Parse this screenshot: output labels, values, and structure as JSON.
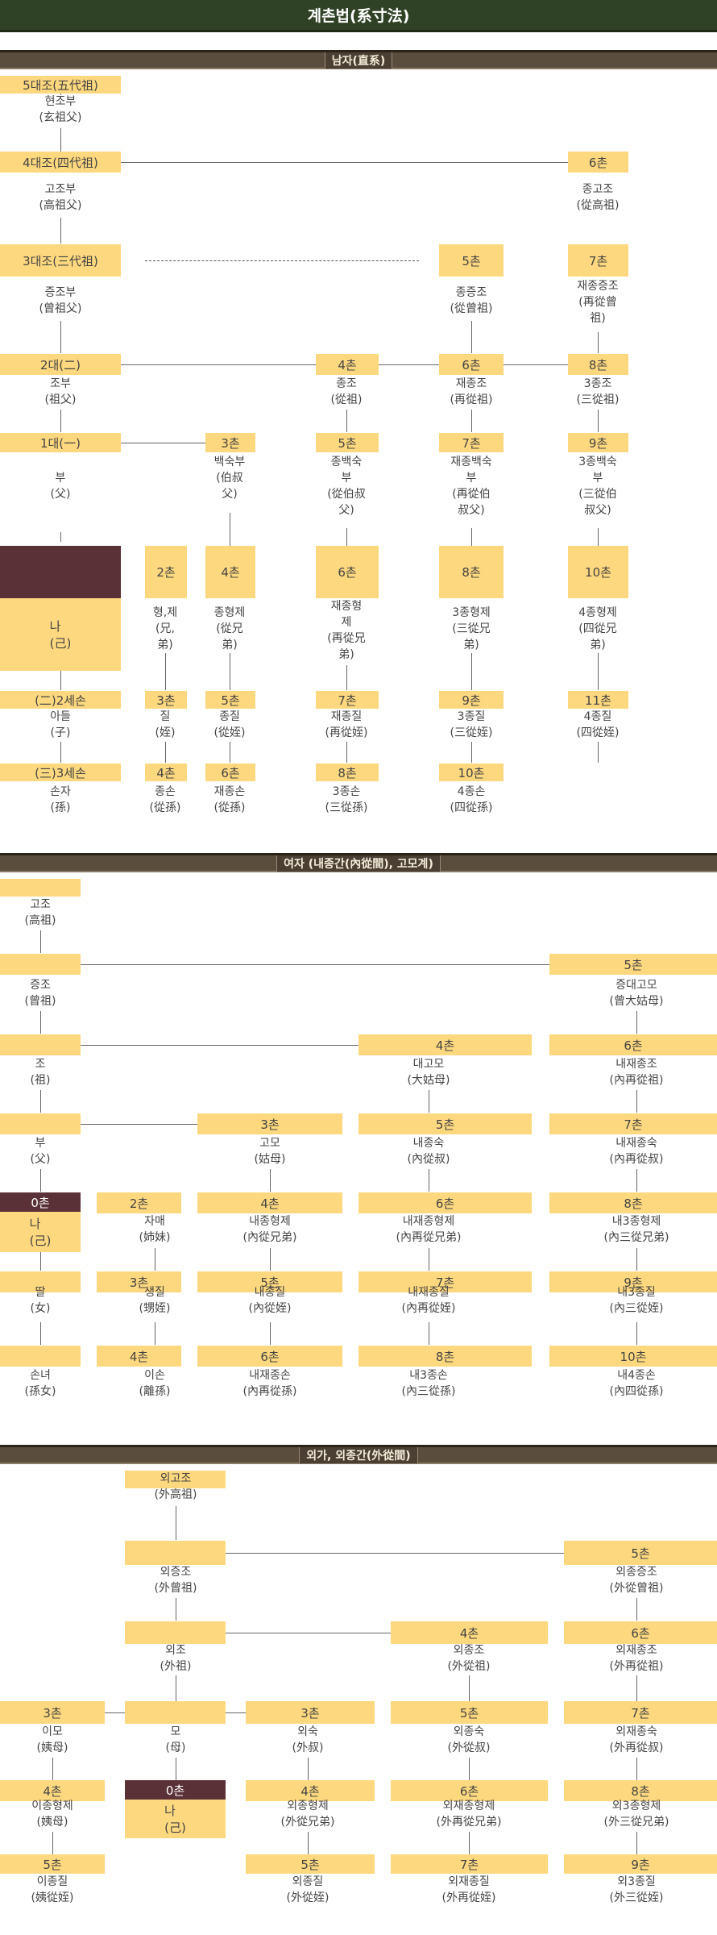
{
  "title": "계촌법(系寸法)",
  "section_headers": [
    "남자(直系)",
    "여자 (내종간(內從間), 고모계)",
    "외가, 외종간(外從間)"
  ],
  "male": {
    "boxes": [
      "5대조(五代祖)",
      "4대조(四代祖)",
      "6촌",
      "3대조(三代祖)",
      "5촌",
      "7촌",
      "2대(二)",
      "4촌",
      "6촌",
      "8촌",
      "1대(一)",
      "3촌",
      "5촌",
      "7촌",
      "9촌",
      "2촌",
      "4촌",
      "6촌",
      "8촌",
      "10촌",
      "(二)2세손",
      "3촌",
      "5촌",
      "7촌",
      "9촌",
      "11촌",
      "(三)3세손",
      "4촌",
      "6촌",
      "8촌",
      "10촌"
    ],
    "me_label": "나\n(己)",
    "labels": [
      "현조부\n(玄祖父)",
      "고조부\n(高祖父)",
      "종고조\n(從高祖)",
      "증조부\n(曾祖父)",
      "종증조\n(從曾祖)",
      "재종증조\n(再從曾\n祖)",
      "조부\n(祖父)",
      "종조\n(從祖)",
      "재종조\n(再從祖)",
      "3종조\n(三從祖)",
      "부\n(父)",
      "백숙부\n(伯叔\n父)",
      "종백숙\n부\n(從伯叔\n父)",
      "재종백숙\n부\n(再從伯\n叔父)",
      "3종백숙\n부\n(三從伯\n叔父)",
      "형,제\n(兄,\n弟)",
      "종형제\n(從兄\n弟)",
      "재종형\n제\n(再從兄\n弟)",
      "3종형제\n(三從兄\n弟)",
      "4종형제\n(四從兄\n弟)",
      "아들\n(子)",
      "질\n(姪)",
      "종질\n(從姪)",
      "재종질\n(再從姪)",
      "3종질\n(三從姪)",
      "4종질\n(四從姪)",
      "손자\n(孫)",
      "종손\n(從孫)",
      "재종손\n(從孫)",
      "3종손\n(三從孫)",
      "4종손\n(四從孫)"
    ]
  },
  "female": {
    "boxes": [
      "5촌",
      "4촌",
      "6촌",
      "3촌",
      "5촌",
      "7촌",
      "0촌",
      "2촌",
      "4촌",
      "6촌",
      "8촌",
      "3촌",
      "5촌",
      "7촌",
      "9촌",
      "4촌",
      "6촌",
      "8촌",
      "10촌"
    ],
    "me_label": "나\n(己)",
    "labels": [
      "고조\n(高祖)",
      "증조\n(曾祖)",
      "증대고모\n(曾大姑母)",
      "조\n(祖)",
      "대고모\n(大姑母)",
      "내재종조\n(內再從祖)",
      "부\n(父)",
      "고모\n(姑母)",
      "내종숙\n(內從叔)",
      "내재종숙\n(內再從叔)",
      "자매\n(姉妹)",
      "내종형제\n(內從兄弟)",
      "내재종형제\n(內再從兄弟)",
      "내3종형제\n(內三從兄弟)",
      "딸\n(女)",
      "생질\n(甥姪)",
      "내종질\n(內從姪)",
      "내재종질\n(內再從姪)",
      "내3종질\n(內三從姪)",
      "손녀\n(孫女)",
      "이손\n(離孫)",
      "내재종손\n(內再從孫)",
      "내3종손\n(內三從孫)",
      "내4종손\n(內四從孫)"
    ]
  },
  "maternal": {
    "boxes": [
      "5촌",
      "4촌",
      "6촌",
      "3촌",
      "3촌",
      "5촌",
      "7촌",
      "4촌",
      "0촌",
      "4촌",
      "6촌",
      "8촌",
      "5촌",
      "5촌",
      "7촌",
      "9촌"
    ],
    "me_label": "나\n(己)",
    "labels": [
      "외고조\n(外高祖)",
      "외증조\n(外曾祖)",
      "외종증조\n(外從曾祖)",
      "외조\n(外祖)",
      "외종조\n(外從祖)",
      "외재종조\n(外再從祖)",
      "이모\n(姨母)",
      "모\n(母)",
      "외숙\n(外叔)",
      "외종숙\n(外從叔)",
      "외재종숙\n(外再從叔)",
      "이종형제\n(姨母)",
      "외종형제\n(外從兄弟)",
      "외재종형제\n(外再從兄弟)",
      "외3종형제\n(外三從兄弟)",
      "이종질\n(姨從姪)",
      "외종질\n(外從姪)",
      "외재종질\n(外再從姪)",
      "외3종질\n(外三從姪)"
    ]
  }
}
